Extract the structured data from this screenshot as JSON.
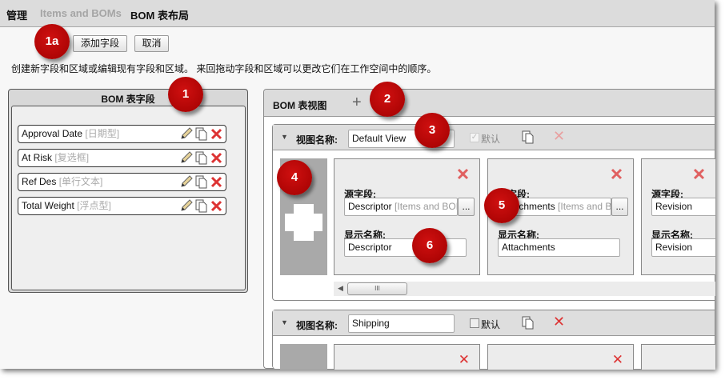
{
  "breadcrumb": {
    "root": "管理",
    "section": "Items and BOMs",
    "current": "BOM 表布局"
  },
  "toolbar": {
    "add_field": "添加字段",
    "cancel": "取消"
  },
  "description": "创建新字段和区域或编辑现有字段和区域。 来回拖动字段和区域可以更改它们在工作空间中的顺序。",
  "fields_panel": {
    "title": "BOM 表字段",
    "items": [
      {
        "name": "Approval Date",
        "type": "[日期型]"
      },
      {
        "name": "At Risk",
        "type": "[复选框]"
      },
      {
        "name": "Ref Des",
        "type": "[单行文本]"
      },
      {
        "name": "Total Weight",
        "type": "[浮点型]"
      }
    ]
  },
  "views_panel": {
    "title": "BOM 表视图",
    "view_name_label": "视图名称:",
    "default_label": "默认",
    "source_label": "源字段:",
    "display_label": "显示名称:",
    "browse": "...",
    "scroll_thumb": "III",
    "views": [
      {
        "name": "Default View",
        "default": true,
        "columns": [
          {
            "source": "Descriptor",
            "source_hint": "[Items and BOMs]",
            "display": "Descriptor"
          },
          {
            "source": "Attachments",
            "source_hint": "[Items and BOMs]",
            "display": "Attachments"
          },
          {
            "source": "Revision",
            "source_hint": "",
            "display": "Revision"
          }
        ]
      },
      {
        "name": "Shipping",
        "default": false
      }
    ]
  },
  "callouts": [
    "1a",
    "1",
    "2",
    "3",
    "4",
    "5",
    "6"
  ],
  "colors": {
    "badge": "#c00000",
    "delete": "#d33"
  }
}
